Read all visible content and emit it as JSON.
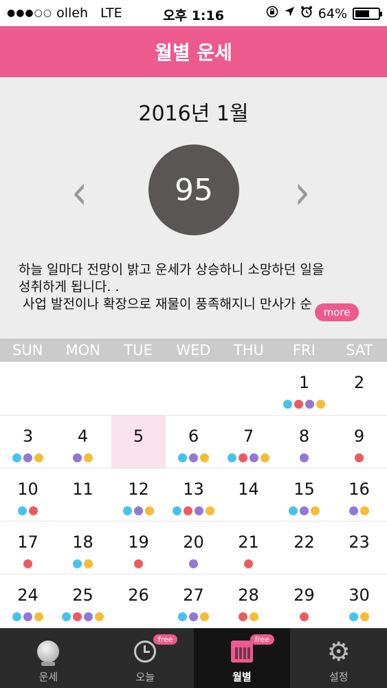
{
  "status_bar": {
    "signal": "●●●○○",
    "carrier": "olleh",
    "network": "LTE",
    "time": "오후 1:16",
    "icons": [
      "rotation-lock-icon",
      "location-arrow-icon",
      "alarm-icon"
    ],
    "battery": "64%",
    "battery_level": 0.64
  },
  "header": {
    "title": "월별 운세"
  },
  "summary": {
    "month": "2016년 1월",
    "score": "95",
    "fortune_lines": [
      "하늘 일마다 전망이 밝고 운세가 상승하니 소망하던 일을",
      "성취하게 됩니다. .",
      "사업 발전이나 확장으로 재물이 풍족해지니 만사가 순"
    ],
    "more_label": "more",
    "prev_icon": "chevron-left-icon",
    "next_icon": "chevron-right-icon"
  },
  "weekdays": [
    "SUN",
    "MON",
    "TUE",
    "WED",
    "THU",
    "FRI",
    "SAT"
  ],
  "calendar": {
    "today": 5,
    "weeks": [
      [
        null,
        null,
        null,
        null,
        null,
        {
          "day": 1,
          "dots": [
            "blue",
            "red",
            "purple",
            "yellow"
          ]
        },
        {
          "day": 2,
          "dots": []
        }
      ],
      [
        {
          "day": 3,
          "dots": [
            "blue",
            "purple",
            "yellow"
          ]
        },
        {
          "day": 4,
          "dots": [
            "purple",
            "yellow"
          ]
        },
        {
          "day": 5,
          "dots": []
        },
        {
          "day": 6,
          "dots": [
            "blue",
            "purple",
            "yellow"
          ]
        },
        {
          "day": 7,
          "dots": [
            "blue",
            "red",
            "purple",
            "yellow"
          ]
        },
        {
          "day": 8,
          "dots": [
            "purple"
          ]
        },
        {
          "day": 9,
          "dots": [
            "red"
          ]
        }
      ],
      [
        {
          "day": 10,
          "dots": [
            "blue",
            "red"
          ]
        },
        {
          "day": 11,
          "dots": []
        },
        {
          "day": 12,
          "dots": [
            "blue",
            "purple",
            "yellow"
          ]
        },
        {
          "day": 13,
          "dots": [
            "blue",
            "red",
            "purple",
            "yellow"
          ]
        },
        {
          "day": 14,
          "dots": []
        },
        {
          "day": 15,
          "dots": [
            "blue",
            "purple",
            "yellow"
          ]
        },
        {
          "day": 16,
          "dots": [
            "purple",
            "yellow"
          ]
        }
      ],
      [
        {
          "day": 17,
          "dots": [
            "red"
          ]
        },
        {
          "day": 18,
          "dots": [
            "blue",
            "yellow"
          ]
        },
        {
          "day": 19,
          "dots": [
            "red"
          ]
        },
        {
          "day": 20,
          "dots": [
            "purple"
          ]
        },
        {
          "day": 21,
          "dots": [
            "red"
          ]
        },
        {
          "day": 22,
          "dots": []
        },
        {
          "day": 23,
          "dots": []
        }
      ],
      [
        {
          "day": 24,
          "dots": [
            "blue",
            "purple",
            "yellow"
          ]
        },
        {
          "day": 25,
          "dots": [
            "blue",
            "red",
            "purple",
            "yellow"
          ]
        },
        {
          "day": 26,
          "dots": []
        },
        {
          "day": 27,
          "dots": [
            "blue",
            "purple",
            "yellow"
          ]
        },
        {
          "day": 28,
          "dots": [
            "red",
            "yellow"
          ]
        },
        {
          "day": 29,
          "dots": [
            "red"
          ]
        },
        {
          "day": 30,
          "dots": [
            "blue",
            "yellow"
          ]
        }
      ]
    ]
  },
  "tabs": [
    {
      "label": "운세",
      "icon": "crystal-ball-icon",
      "badge": "",
      "active": false
    },
    {
      "label": "오늘",
      "icon": "clock-icon",
      "badge": "free",
      "active": false
    },
    {
      "label": "월별",
      "icon": "calendar-icon",
      "badge": "free",
      "active": true
    },
    {
      "label": "설정",
      "icon": "gear-icon",
      "badge": "",
      "active": false
    }
  ],
  "colors": {
    "accent": "#ec5a8e",
    "dot_blue": "#45c3ee",
    "dot_red": "#ee5a5f",
    "dot_purple": "#9377d6",
    "dot_yellow": "#f5bd34",
    "today_bg": "#fae2ec"
  }
}
